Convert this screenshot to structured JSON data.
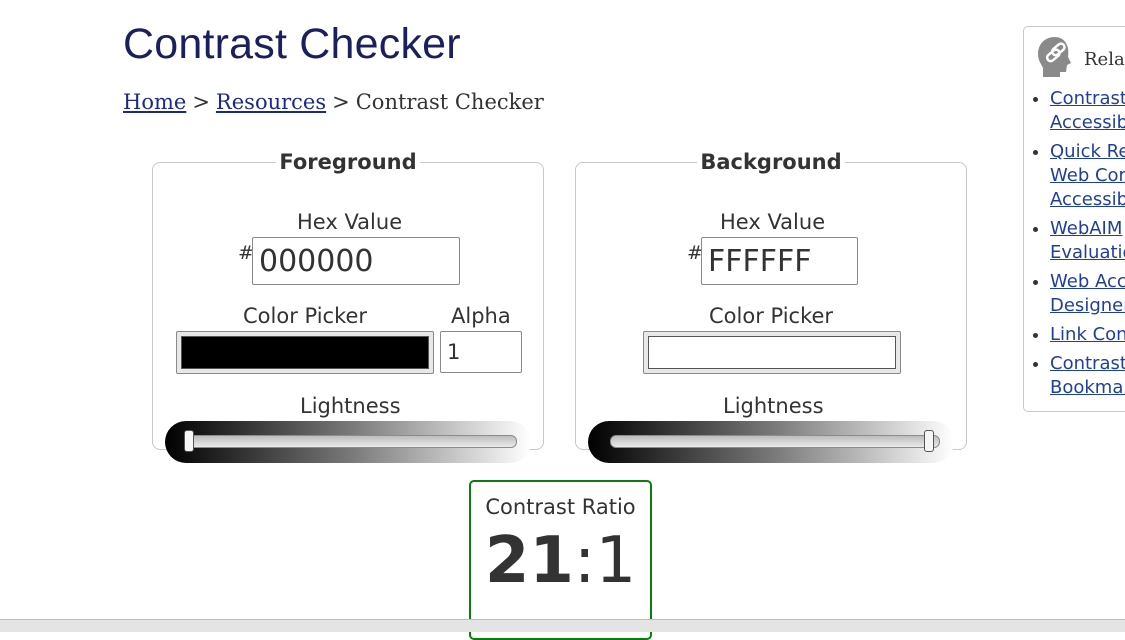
{
  "page": {
    "title": "Contrast Checker"
  },
  "breadcrumb": {
    "home": "Home",
    "resources": "Resources",
    "current": "Contrast Checker",
    "separator": ">"
  },
  "foreground": {
    "legend": "Foreground",
    "hex_label": "Hex Value",
    "hash": "#",
    "hex_value": "000000",
    "color_picker_label": "Color Picker",
    "swatch_color": "#000000",
    "alpha_label": "Alpha",
    "alpha_value": "1",
    "lightness_label": "Lightness",
    "lightness_value": 0
  },
  "background": {
    "legend": "Background",
    "hex_label": "Hex Value",
    "hash": "#",
    "hex_value": "FFFFFF",
    "color_picker_label": "Color Picker",
    "swatch_color": "#FFFFFF",
    "lightness_label": "Lightness",
    "lightness_value": 100
  },
  "contrast": {
    "label": "Contrast Ratio",
    "ratio_left": "21",
    "ratio_colon": ":",
    "ratio_right": "1",
    "border_color": "#0b7d0b"
  },
  "related": {
    "title": "Rela",
    "icon": "chain-link-head-icon",
    "items": [
      {
        "line1": "Contrast",
        "line2": "Accessib"
      },
      {
        "line1": "Quick Re",
        "line2": "Web Cor",
        "line3": "Accessib"
      },
      {
        "line1": "WebAIM",
        "line2": "Evaluatio"
      },
      {
        "line1": "Web Acc",
        "line2": "Designer"
      },
      {
        "line1": "Link Con"
      },
      {
        "line1": "Contrast",
        "line2": "Bookmar"
      }
    ]
  }
}
